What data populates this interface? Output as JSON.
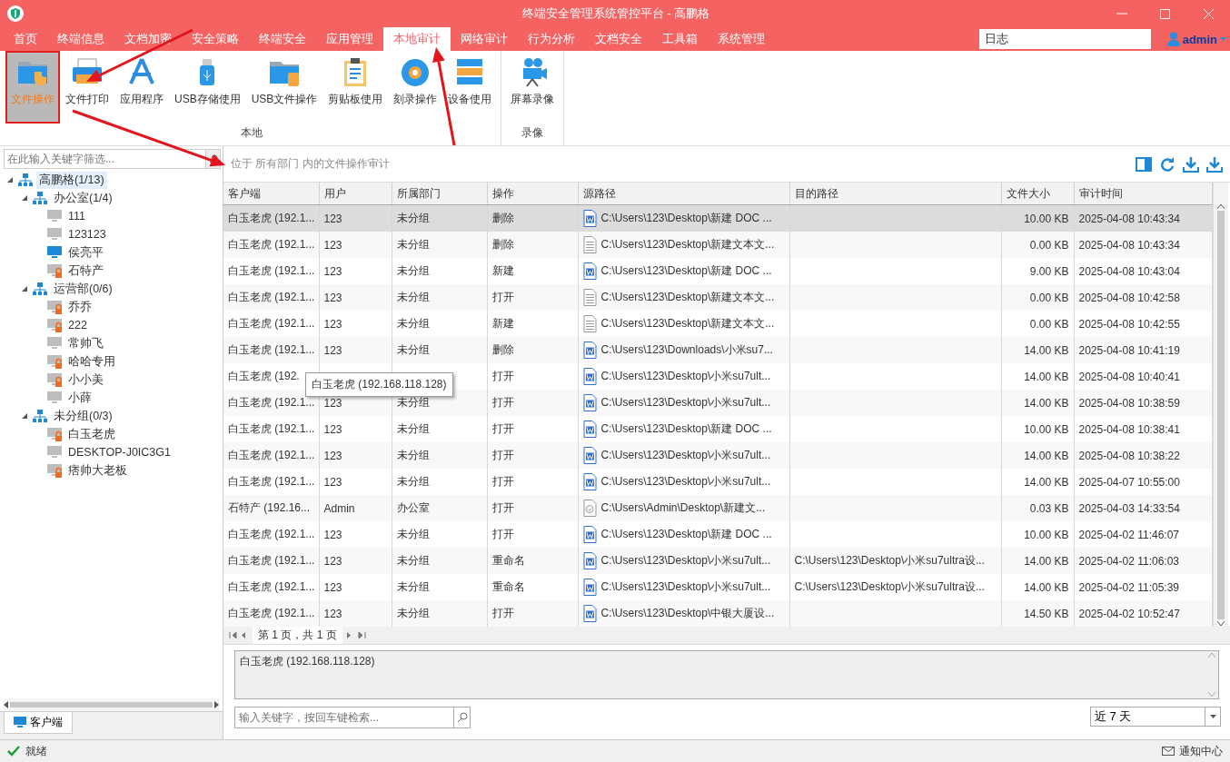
{
  "window": {
    "title": "终端安全管理系统管控平台 - 高鹏格"
  },
  "menu_tabs": [
    {
      "label": "首页",
      "selected": false
    },
    {
      "label": "终端信息",
      "selected": false
    },
    {
      "label": "文档加密",
      "selected": false
    },
    {
      "label": "安全策略",
      "selected": false
    },
    {
      "label": "终端安全",
      "selected": false
    },
    {
      "label": "应用管理",
      "selected": false
    },
    {
      "label": "本地审计",
      "selected": true
    },
    {
      "label": "网络审计",
      "selected": false
    },
    {
      "label": "行为分析",
      "selected": false
    },
    {
      "label": "文档安全",
      "selected": false
    },
    {
      "label": "工具箱",
      "selected": false
    },
    {
      "label": "系统管理",
      "selected": false
    }
  ],
  "header_search": {
    "value": "日志"
  },
  "user": {
    "name": "admin"
  },
  "ribbon": {
    "groups": [
      {
        "label": "本地",
        "items": [
          {
            "label": "文件操作",
            "selected": true
          },
          {
            "label": "文件打印",
            "selected": false
          },
          {
            "label": "应用程序",
            "selected": false
          },
          {
            "label": "USB存储使用",
            "selected": false
          },
          {
            "label": "USB文件操作",
            "selected": false
          },
          {
            "label": "剪贴板使用",
            "selected": false
          },
          {
            "label": "刻录操作",
            "selected": false
          },
          {
            "label": "设备使用",
            "selected": false
          }
        ]
      },
      {
        "label": "录像",
        "items": [
          {
            "label": "屏幕录像",
            "selected": false
          }
        ]
      }
    ]
  },
  "sidebar": {
    "filter": {
      "placeholder": "在此输入关键字筛选..."
    },
    "tree": [
      {
        "label": "高鹏格(1/13)",
        "kind": "group",
        "expanded": true,
        "selected": true,
        "children": [
          {
            "label": "办公室(1/4)",
            "kind": "group",
            "expanded": true,
            "selected": false,
            "children": [
              {
                "label": "111",
                "kind": "computer",
                "online": false,
                "locked": false,
                "selected": false
              },
              {
                "label": "123123",
                "kind": "computer",
                "online": false,
                "locked": false,
                "selected": false
              },
              {
                "label": "侯亮平",
                "kind": "computer",
                "online": true,
                "locked": false,
                "selected": false
              },
              {
                "label": "石特产",
                "kind": "computer",
                "online": false,
                "locked": true,
                "selected": false
              }
            ]
          },
          {
            "label": "运营部(0/6)",
            "kind": "group",
            "expanded": true,
            "selected": false,
            "children": [
              {
                "label": "乔乔",
                "kind": "computer",
                "online": false,
                "locked": true,
                "selected": false
              },
              {
                "label": "222",
                "kind": "computer",
                "online": false,
                "locked": true,
                "selected": false
              },
              {
                "label": "常帅飞",
                "kind": "computer",
                "online": false,
                "locked": false,
                "selected": false
              },
              {
                "label": "哈哈专用",
                "kind": "computer",
                "online": false,
                "locked": true,
                "selected": false
              },
              {
                "label": "小小美",
                "kind": "computer",
                "online": false,
                "locked": true,
                "selected": false
              },
              {
                "label": "小薛",
                "kind": "computer",
                "online": false,
                "locked": false,
                "selected": false
              }
            ]
          },
          {
            "label": "未分组(0/3)",
            "kind": "group",
            "expanded": true,
            "selected": false,
            "children": [
              {
                "label": "白玉老虎",
                "kind": "computer",
                "online": false,
                "locked": true,
                "selected": false
              },
              {
                "label": "DESKTOP-J0IC3G1",
                "kind": "computer",
                "online": false,
                "locked": false,
                "selected": false
              },
              {
                "label": "痞帅大老板",
                "kind": "computer",
                "online": false,
                "locked": true,
                "selected": false
              }
            ]
          }
        ]
      }
    ],
    "tabs": [
      {
        "label": "客户端",
        "selected": true
      }
    ]
  },
  "content": {
    "breadcrumb": "位于 所有部门 内的文件操作审计",
    "table": {
      "columns": [
        "客户端",
        "用户",
        "所属部门",
        "操作",
        "源路径",
        "目的路径",
        "文件大小",
        "审计时间"
      ],
      "rows": [
        {
          "client": "白玉老虎 (192.1...",
          "user": "123",
          "department": "未分组",
          "operation": "删除",
          "kind": "word",
          "source": "C:\\Users\\123\\Desktop\\新建 DOC ...",
          "size": "10.00 KB",
          "time": "2025-04-08 10:43:34",
          "selected": true
        },
        {
          "client": "白玉老虎 (192.1...",
          "user": "123",
          "department": "未分组",
          "operation": "删除",
          "kind": "text",
          "source": "C:\\Users\\123\\Desktop\\新建文本文...",
          "size": "0.00 KB",
          "time": "2025-04-08 10:43:34",
          "selected": false
        },
        {
          "client": "白玉老虎 (192.1...",
          "user": "123",
          "department": "未分组",
          "operation": "新建",
          "kind": "word",
          "source": "C:\\Users\\123\\Desktop\\新建 DOC ...",
          "size": "9.00 KB",
          "time": "2025-04-08 10:43:04",
          "selected": false
        },
        {
          "client": "白玉老虎 (192.1...",
          "user": "123",
          "department": "未分组",
          "operation": "打开",
          "kind": "text",
          "source": "C:\\Users\\123\\Desktop\\新建文本文...",
          "size": "0.00 KB",
          "time": "2025-04-08 10:42:58",
          "selected": false
        },
        {
          "client": "白玉老虎 (192.1...",
          "user": "123",
          "department": "未分组",
          "operation": "新建",
          "kind": "text",
          "source": "C:\\Users\\123\\Desktop\\新建文本文...",
          "size": "0.00 KB",
          "time": "2025-04-08 10:42:55",
          "selected": false
        },
        {
          "client": "白玉老虎 (192.1...",
          "user": "123",
          "department": "未分组",
          "operation": "删除",
          "kind": "word",
          "source": "C:\\Users\\123\\Downloads\\小米su7...",
          "size": "14.00 KB",
          "time": "2025-04-08 10:41:19",
          "selected": false
        },
        {
          "client": "白玉老虎 (192.",
          "operation": "打开",
          "kind": "word",
          "source": "C:\\Users\\123\\Desktop\\小米su7ult...",
          "size": "14.00 KB",
          "time": "2025-04-08 10:40:41",
          "selected": false
        },
        {
          "client": "白玉老虎 (192.1...",
          "user": "123",
          "department": "未分组",
          "operation": "打开",
          "kind": "word",
          "source": "C:\\Users\\123\\Desktop\\小米su7ult...",
          "size": "14.00 KB",
          "time": "2025-04-08 10:38:59",
          "selected": false
        },
        {
          "client": "白玉老虎 (192.1...",
          "user": "123",
          "department": "未分组",
          "operation": "打开",
          "kind": "word",
          "source": "C:\\Users\\123\\Desktop\\新建 DOC ...",
          "size": "10.00 KB",
          "time": "2025-04-08 10:38:41",
          "selected": false
        },
        {
          "client": "白玉老虎 (192.1...",
          "user": "123",
          "department": "未分组",
          "operation": "打开",
          "kind": "word",
          "source": "C:\\Users\\123\\Desktop\\小米su7ult...",
          "size": "14.00 KB",
          "time": "2025-04-08 10:38:22",
          "selected": false
        },
        {
          "client": "白玉老虎 (192.1...",
          "user": "123",
          "department": "未分组",
          "operation": "打开",
          "kind": "word",
          "source": "C:\\Users\\123\\Desktop\\小米su7ult...",
          "size": "14.00 KB",
          "time": "2025-04-07 10:55:00",
          "selected": false
        },
        {
          "client": "石特产 (192.16...",
          "user": "Admin",
          "department": "办公室",
          "operation": "打开",
          "kind": "image",
          "source": "C:\\Users\\Admin\\Desktop\\新建文...",
          "size": "0.03 KB",
          "time": "2025-04-03 14:33:54",
          "selected": false
        },
        {
          "client": "白玉老虎 (192.1...",
          "user": "123",
          "department": "未分组",
          "operation": "打开",
          "kind": "word",
          "source": "C:\\Users\\123\\Desktop\\新建 DOC ...",
          "size": "10.00 KB",
          "time": "2025-04-02 11:46:07",
          "selected": false
        },
        {
          "client": "白玉老虎 (192.1...",
          "user": "123",
          "department": "未分组",
          "operation": "重命名",
          "kind": "word",
          "source": "C:\\Users\\123\\Desktop\\小米su7ult...",
          "destination": "C:\\Users\\123\\Desktop\\小米su7ultra设...",
          "size": "14.00 KB",
          "time": "2025-04-02 11:06:03",
          "selected": false
        },
        {
          "client": "白玉老虎 (192.1...",
          "user": "123",
          "department": "未分组",
          "operation": "重命名",
          "kind": "word",
          "source": "C:\\Users\\123\\Desktop\\小米su7ult...",
          "destination": "C:\\Users\\123\\Desktop\\小米su7ultra设...",
          "size": "14.00 KB",
          "time": "2025-04-02 11:05:39",
          "selected": false
        },
        {
          "client": "白玉老虎 (192.1...",
          "user": "123",
          "department": "未分组",
          "operation": "打开",
          "kind": "word",
          "source": "C:\\Users\\123\\Desktop\\中银大厦设...",
          "size": "14.50 KB",
          "time": "2025-04-02 10:52:47",
          "selected": false
        }
      ]
    },
    "tooltip": "白玉老虎 (192.168.118.128)",
    "pager": "第 1 页，共 1 页",
    "detail": "白玉老虎 (192.168.118.128)",
    "search": {
      "placeholder": "输入关键字，按回车键检索..."
    },
    "range": {
      "value": "近 7 天"
    }
  },
  "status_bar": {
    "status": "就绪",
    "notification": "通知中心"
  }
}
